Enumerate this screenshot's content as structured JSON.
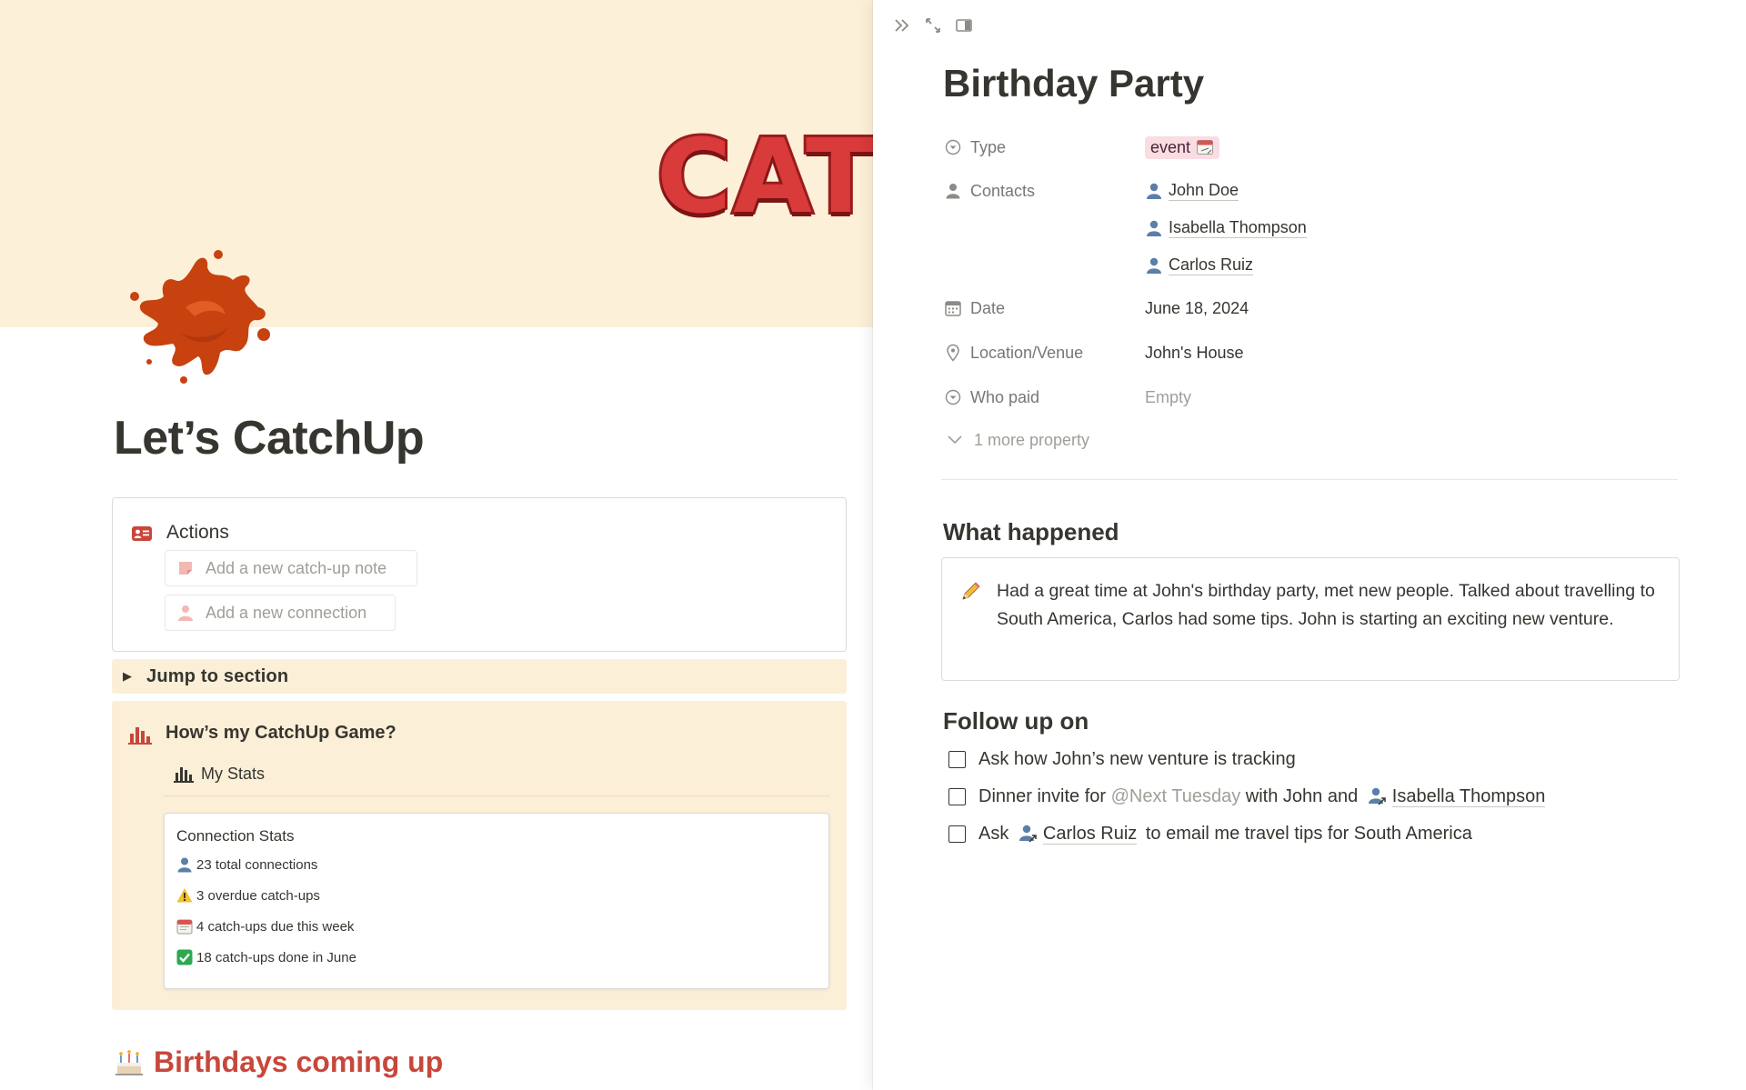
{
  "left_page": {
    "cover_word": "CATC",
    "title": "Let’s CatchUp",
    "actions": {
      "title": "Actions",
      "buttons": [
        "Add a new catch-up note",
        "Add a new connection"
      ]
    },
    "jump_toggle": "Jump to section",
    "game": {
      "title": "How’s my CatchUp Game?",
      "stats_heading": "My Stats",
      "card_title": "Connection Stats",
      "stats": [
        {
          "icon": "person-icon",
          "text": "23 total connections"
        },
        {
          "icon": "warning-icon",
          "text": "3 overdue catch-ups"
        },
        {
          "icon": "calendar-icon",
          "text": "4 catch-ups due this week"
        },
        {
          "icon": "check-icon",
          "text": "18 catch-ups done in June"
        }
      ]
    },
    "birthdays_heading": "Birthdays coming up"
  },
  "peek": {
    "title": "Birthday Party",
    "properties": {
      "type": {
        "name": "Type",
        "value": "event"
      },
      "contacts": {
        "name": "Contacts",
        "values": [
          "John Doe",
          "Isabella Thompson",
          "Carlos Ruiz"
        ]
      },
      "date": {
        "name": "Date",
        "value": "June 18, 2024"
      },
      "location": {
        "name": "Location/Venue",
        "value": "John's House"
      },
      "who_paid": {
        "name": "Who paid",
        "value": "Empty"
      }
    },
    "more_properties": "1 more property",
    "what_happened": {
      "heading": "What happened",
      "text": "Had a great time at John's birthday party, met new people. Talked about travelling to South America, Carlos had some tips. John is starting an exciting new venture."
    },
    "follow_up": {
      "heading": "Follow up on",
      "todo1": "Ask how John’s new venture is tracking",
      "todo2": {
        "pre": "Dinner invite for",
        "mention": "@Next Tuesday",
        "mid": "with John and",
        "person": "Isabella Thompson"
      },
      "todo3": {
        "pre": "Ask",
        "person": "Carlos Ruiz",
        "post": "to email me travel tips for South America"
      }
    }
  },
  "colors": {
    "cover_bg": "#fcf0d9",
    "callout_bg": "#fbefd8",
    "accent_red": "#c8473b",
    "tag_pink": "#f9dde3",
    "text": "#37352f",
    "muted": "#787774"
  }
}
